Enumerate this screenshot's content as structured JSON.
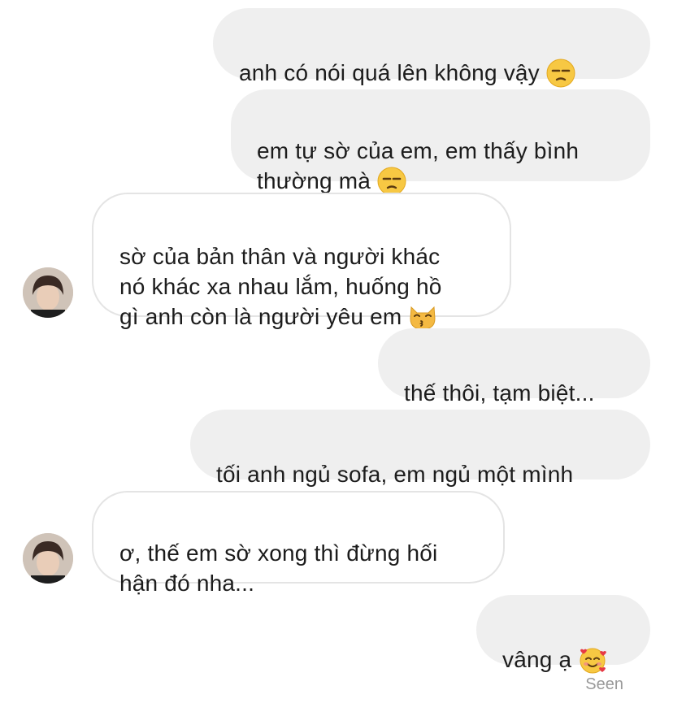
{
  "messages": [
    {
      "text": "anh có nói quá lên không vậy",
      "emoji": "unamused-face-icon"
    },
    {
      "text": "em tự sờ của em, em thấy bình\nthường mà",
      "emoji": "unamused-face-icon"
    },
    {
      "text": "sờ của bản thân và người khác\nnó khác xa nhau lắm, huống hồ\ngì anh còn là người yêu em",
      "emoji": "kissing-cat-icon"
    },
    {
      "text": "thế thôi, tạm biệt..."
    },
    {
      "text": "tối anh ngủ sofa, em ngủ một mình"
    },
    {
      "text": "ơ, thế em sờ xong thì đừng hối\nhận đó nha..."
    },
    {
      "text": "vâng ạ",
      "emoji": "smiling-face-with-hearts-icon"
    }
  ],
  "status": {
    "seen": "Seen"
  }
}
